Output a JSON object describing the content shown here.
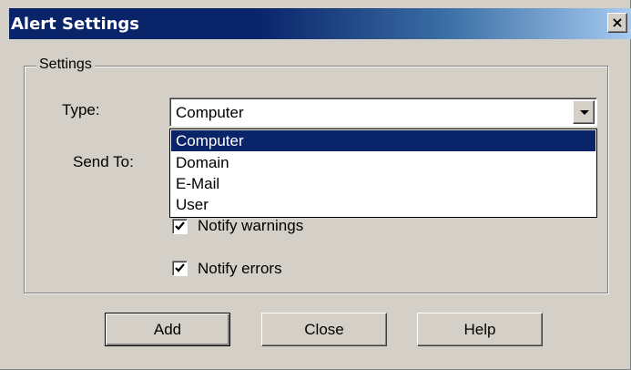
{
  "window": {
    "title": "Alert Settings",
    "close_glyph": "×"
  },
  "group": {
    "legend": "Settings"
  },
  "type_field": {
    "label": "Type:",
    "value": "Computer",
    "options": [
      "Computer",
      "Domain",
      "E-Mail",
      "User"
    ],
    "selected_index": 0,
    "dropdown_open": true
  },
  "send_to": {
    "label": "Send To:"
  },
  "checkboxes": [
    {
      "label": "Notify warnings",
      "checked": true
    },
    {
      "label": "Notify errors",
      "checked": true
    }
  ],
  "buttons": {
    "add": "Add",
    "close": "Close",
    "help": "Help"
  },
  "colors": {
    "titlebar": "#0a246a",
    "selection": "#0a246a",
    "face": "#d4d0c8"
  }
}
